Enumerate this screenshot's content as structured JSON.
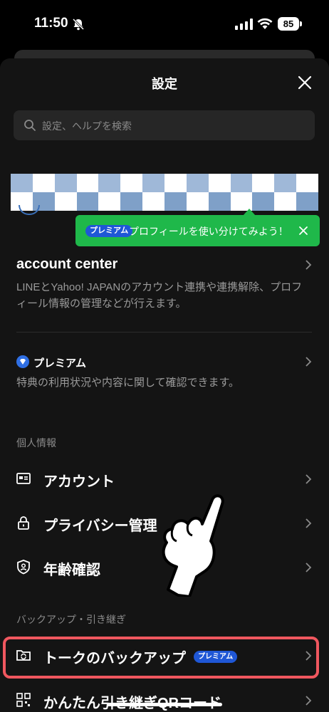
{
  "status": {
    "time": "11:50",
    "battery": "85"
  },
  "header": {
    "title": "設定"
  },
  "search": {
    "placeholder": "設定、ヘルプを検索"
  },
  "tooltip": {
    "badge": "プレミアム",
    "text": "プロフィールを使い分けてみよう！"
  },
  "account_center": {
    "title": "account center",
    "description": "LINEとYahoo! JAPANのアカウント連携や連携解除、プロフィール情報の管理などが行えます。"
  },
  "premium": {
    "title": "プレミアム",
    "description": "特典の利用状況や内容に関して確認できます。"
  },
  "personal": {
    "label": "個人情報",
    "items": [
      {
        "label": "アカウント",
        "icon": "id-card-icon"
      },
      {
        "label": "プライバシー管理",
        "icon": "lock-icon"
      },
      {
        "label": "年齢確認",
        "icon": "shield-person-icon"
      }
    ]
  },
  "backup": {
    "label": "バックアップ・引き継ぎ",
    "items": [
      {
        "label": "トークのバックアップ",
        "badge": "プレミアム",
        "icon": "backup-folder-icon"
      },
      {
        "label": "かんたん引き継ぎQRコード",
        "icon": "qr-code-icon"
      }
    ]
  },
  "colors": {
    "background": "#141414",
    "accent_green": "#1fb84a",
    "premium_blue": "#1f57d6",
    "highlight_red": "#f0575f"
  }
}
